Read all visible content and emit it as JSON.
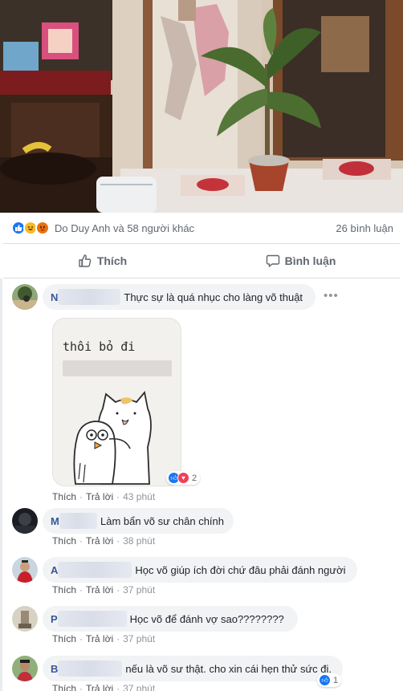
{
  "post": {
    "reactions": {
      "icons": [
        "like-icon",
        "haha-icon",
        "angry-icon"
      ],
      "reactors_text": "Do Duy Anh và 58 người khác",
      "comment_count_text": "26 bình luận"
    },
    "actions": {
      "like_label": "Thích",
      "comment_label": "Bình luận"
    }
  },
  "comments": [
    {
      "initial": "N",
      "text": "Thực sự là quá nhục cho làng võ thuật",
      "sticker_text": "thôi bỏ đi",
      "reaction_count": "2",
      "like": "Thích",
      "reply": "Trả lời",
      "time": "43 phút"
    },
    {
      "initial": "M",
      "text": "Làm bẩn võ sư chân chính",
      "like": "Thích",
      "reply": "Trả lời",
      "time": "38 phút"
    },
    {
      "initial": "A",
      "text": "Học võ giúp ích đời chứ đâu phải đánh người",
      "like": "Thích",
      "reply": "Trả lời",
      "time": "37 phút"
    },
    {
      "initial": "P",
      "text": "Học võ để đánh vợ sao????????",
      "like": "Thích",
      "reply": "Trả lời",
      "time": "37 phút"
    },
    {
      "initial": "B",
      "text": "nếu là võ sư thật. cho xin cái hẹn thử sức đi.",
      "reaction_count": "1",
      "like": "Thích",
      "reply": "Trả lời",
      "time": "37 phút"
    }
  ],
  "colors": {
    "link": "#385898",
    "like_blue": "#1877f2",
    "muted": "#90949c",
    "bubble": "#f2f3f5"
  }
}
